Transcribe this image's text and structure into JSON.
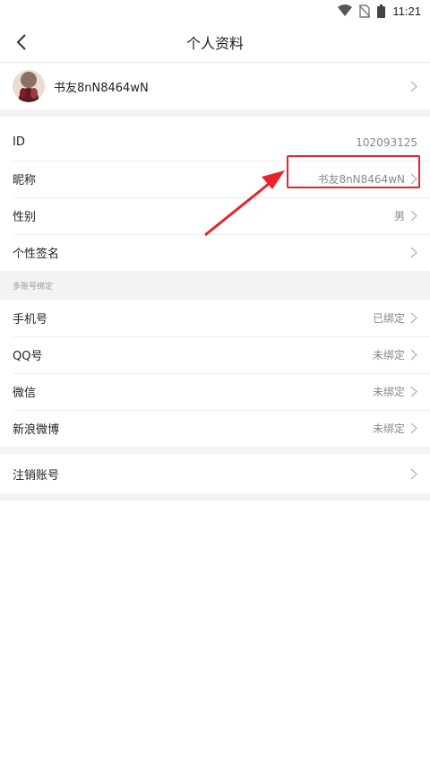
{
  "status_bar": {
    "time": "11:21",
    "icons": [
      "wifi-icon",
      "no-sim-icon",
      "battery-icon"
    ]
  },
  "header": {
    "title": "个人资料",
    "back_icon": "chevron-left-icon"
  },
  "profile": {
    "name": "书友8nN8464wN"
  },
  "basic_info": [
    {
      "label": "ID",
      "value": "102093125",
      "has_chevron": false
    },
    {
      "label": "昵称",
      "value": "书友8nN8464wN",
      "has_chevron": true
    },
    {
      "label": "性别",
      "value": "男",
      "has_chevron": true
    },
    {
      "label": "个性签名",
      "value": "",
      "has_chevron": true
    }
  ],
  "binding_section": {
    "title": "多账号绑定",
    "items": [
      {
        "label": "手机号",
        "value": "已绑定"
      },
      {
        "label": "QQ号",
        "value": "未绑定"
      },
      {
        "label": "微信",
        "value": "未绑定"
      },
      {
        "label": "新浪微博",
        "value": "未绑定"
      }
    ]
  },
  "account": {
    "cancel_label": "注销账号"
  },
  "colors": {
    "annotation_red": "#e8232a",
    "divider_gray": "#f3f3f3",
    "value_gray": "#888888"
  }
}
